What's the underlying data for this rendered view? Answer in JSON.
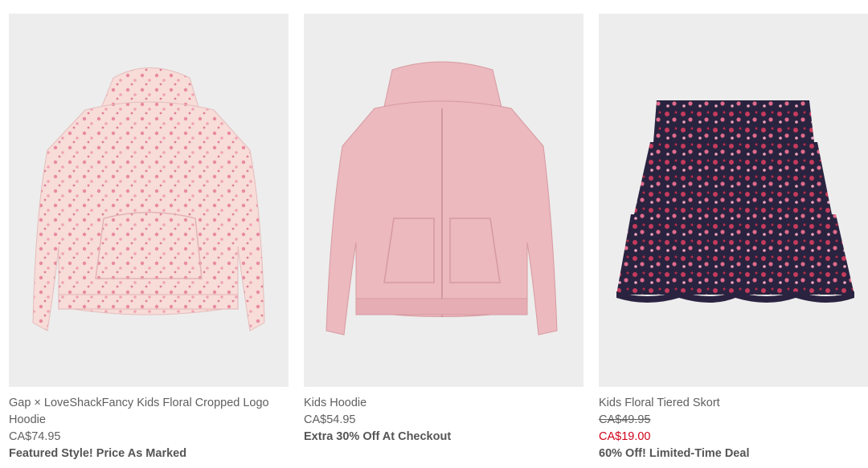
{
  "products": [
    {
      "title": "Gap × LoveShackFancy Kids Floral Cropped Logo Hoodie",
      "image_icon": "pink-floral-hoodie-image",
      "price": "CA$74.95",
      "promo": "Featured Style! Price As Marked"
    },
    {
      "title": "Kids Hoodie",
      "image_icon": "pink-zip-hoodie-image",
      "price": "CA$54.95",
      "promo": "Extra 30% Off At Checkout"
    },
    {
      "title": "Kids Floral Tiered Skort",
      "image_icon": "navy-floral-skort-image",
      "original_price": "CA$49.95",
      "sale_price": "CA$19.00",
      "promo": "60% Off! Limited-Time Deal"
    }
  ],
  "colors": {
    "image_bg": "#ededed",
    "text": "#5f5f5f",
    "sale": "#d0021b",
    "floral_hoodie": "#f6d9d6",
    "zip_hoodie": "#eab8bd",
    "skort": "#2a2340"
  }
}
